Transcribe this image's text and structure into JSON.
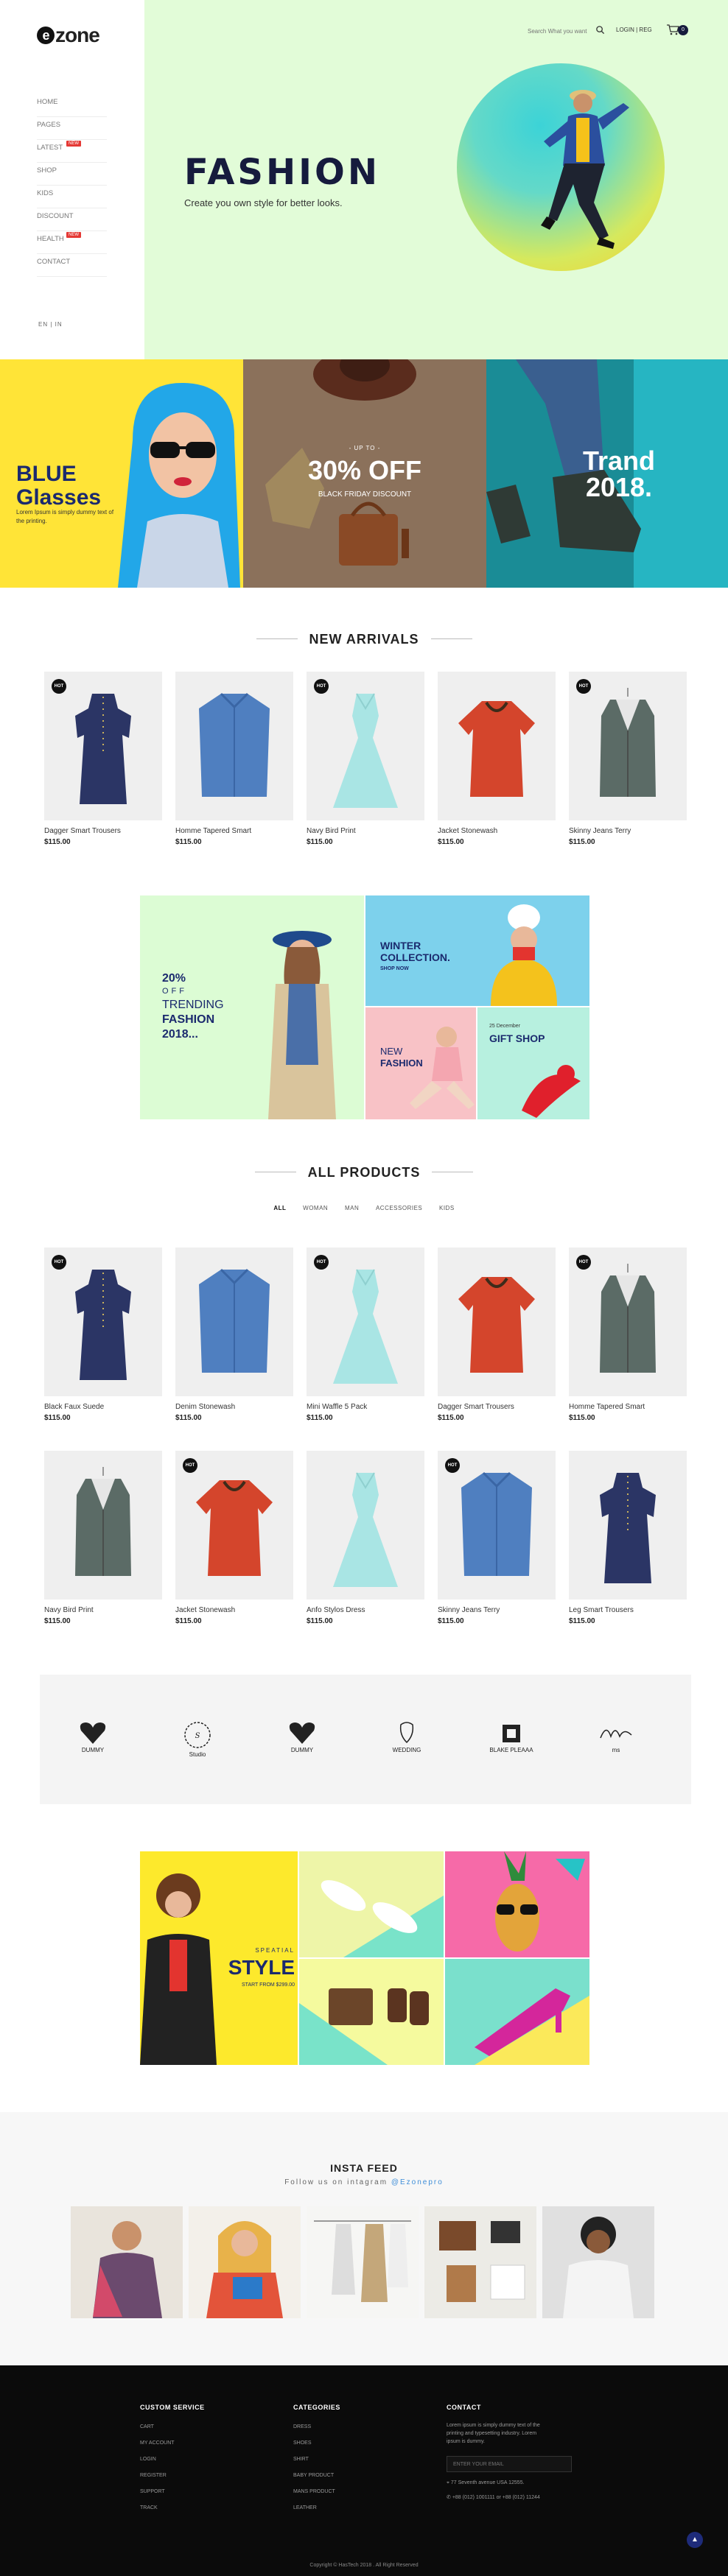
{
  "header": {
    "logo": "zone",
    "logo_mark": "e",
    "nav": [
      {
        "label": "HOME"
      },
      {
        "label": "PAGES"
      },
      {
        "label": "LATEST",
        "badge": "NEW"
      },
      {
        "label": "SHOP"
      },
      {
        "label": "KIDS"
      },
      {
        "label": "DISCOUNT"
      },
      {
        "label": "HEALTH",
        "badge": "NEW"
      },
      {
        "label": "CONTACT"
      }
    ],
    "lang": "EN | IN",
    "search_placeholder": "Search What you want",
    "login": "LOGIN | REG",
    "cart_count": "0"
  },
  "hero": {
    "title": "FASHION",
    "subtitle": "Create you own style for better looks.",
    "bg_color": "#e2fcd8"
  },
  "banners": {
    "blue": {
      "title": "BLUE",
      "title2": "Glasses",
      "text": "Lorem Ipsum is simply dummy text of the printing."
    },
    "sale": {
      "upto": "- UP TO -",
      "value": "30% OFF",
      "text": "BLACK FRIDAY DISCOUNT"
    },
    "trend": {
      "title": "Trand",
      "title2": "2018."
    }
  },
  "new_arrivals": {
    "title": "NEW ARRIVALS",
    "products": [
      {
        "name": "Dagger Smart Trousers",
        "price": "$115.00",
        "hot": true,
        "kind": "dress-navy"
      },
      {
        "name": "Homme Tapered Smart",
        "price": "$115.00",
        "hot": false,
        "kind": "shirt-blue"
      },
      {
        "name": "Navy Bird Print",
        "price": "$115.00",
        "hot": true,
        "kind": "dress-mint"
      },
      {
        "name": "Jacket Stonewash",
        "price": "$115.00",
        "hot": false,
        "kind": "top-red"
      },
      {
        "name": "Skinny Jeans Terry",
        "price": "$115.00",
        "hot": true,
        "kind": "vest-grey"
      }
    ]
  },
  "promo": {
    "left_pct": "20%",
    "left_off": "OFF",
    "left_title": "TRENDING",
    "left_title2": "FASHION",
    "left_title3": "2018...",
    "winter": "WINTER",
    "winter2": "COLLECTION.",
    "winter_btn": "SHOP NOW",
    "new1": "NEW",
    "new2": "FASHION",
    "gift_date": "25 December",
    "gift": "GIFT SHOP"
  },
  "all_products": {
    "title": "ALL PRODUCTS",
    "filters": [
      "ALL",
      "WOMAN",
      "MAN",
      "ACCESSORIES",
      "KIDS"
    ],
    "row1": [
      {
        "name": "Black Faux Suede",
        "price": "$115.00",
        "hot": true,
        "kind": "dress-navy"
      },
      {
        "name": "Denim Stonewash",
        "price": "$115.00",
        "hot": false,
        "kind": "shirt-blue"
      },
      {
        "name": "Mini Waffle 5 Pack",
        "price": "$115.00",
        "hot": true,
        "kind": "dress-mint"
      },
      {
        "name": "Dagger Smart Trousers",
        "price": "$115.00",
        "hot": false,
        "kind": "top-red"
      },
      {
        "name": "Homme Tapered Smart",
        "price": "$115.00",
        "hot": true,
        "kind": "vest-grey"
      }
    ],
    "row2": [
      {
        "name": "Navy Bird Print",
        "price": "$115.00",
        "hot": false,
        "kind": "vest-grey"
      },
      {
        "name": "Jacket Stonewash",
        "price": "$115.00",
        "hot": true,
        "kind": "top-red"
      },
      {
        "name": "Anfo Stylos Dress",
        "price": "$115.00",
        "hot": false,
        "kind": "dress-mint"
      },
      {
        "name": "Skinny Jeans Terry",
        "price": "$115.00",
        "hot": true,
        "kind": "shirt-blue"
      },
      {
        "name": "Leg Smart Trousers",
        "price": "$115.00",
        "hot": false,
        "kind": "dress-navy"
      }
    ]
  },
  "brands": [
    {
      "name": "DUMMY"
    },
    {
      "name": "Studio"
    },
    {
      "name": "DUMMY"
    },
    {
      "name": "WEDDING"
    },
    {
      "name": "BLAKE PLEAAA"
    },
    {
      "name": "ms"
    }
  ],
  "style_banner": {
    "pre": "SPEATIAL",
    "title": "STYLE",
    "sub": "START FROM $299.00"
  },
  "insta": {
    "title": "INSTA FEED",
    "sub": "Follow us on intagram",
    "handle": "@Ezonepro"
  },
  "footer": {
    "col1": {
      "title": "CUSTOM SERVICE",
      "links": [
        "CART",
        "MY ACCOUNT",
        "LOGIN",
        "REGISTER",
        "SUPPORT",
        "TRACK"
      ]
    },
    "col2": {
      "title": "CATEGORIES",
      "links": [
        "DRESS",
        "SHOES",
        "SHIRT",
        "BABY PRODUCT",
        "MANS PRODUCT",
        "LEATHER"
      ]
    },
    "col3": {
      "title": "CONTACT",
      "text": "Lorem ipsum is simply dummy text of the printing and typesetting industry. Lorem ipsum is dummy.",
      "email_placeholder": "ENTER YOUR EMAIL",
      "address": "77 Seventh avenue USA 12555.",
      "phone": "+88 (012) 1001111 or +88 (012) 11244"
    },
    "copyright": "Copyright © HasTech 2018 . All Right Reserved"
  }
}
